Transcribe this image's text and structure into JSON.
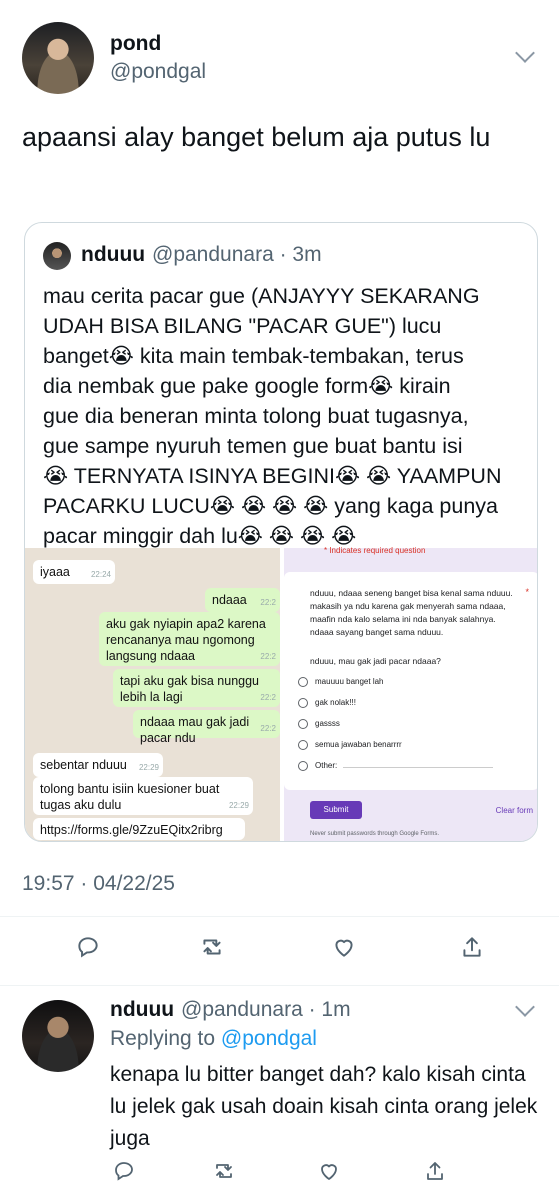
{
  "tweet": {
    "name": "pond",
    "handle": "@pondgal",
    "text": "apaansi alay banget belum aja putus lu",
    "timestamp": "19:57 · 04/22/25"
  },
  "quote": {
    "name": "nduuu",
    "handle_time": "@pandunara · 3m",
    "text_lines": [
      "mau cerita pacar gue (ANJAYYY SEKARANG",
      "UDAH BISA BILANG \"PACAR GUE\") lucu",
      "banget😭 kita main tembak-tembakan, terus",
      "dia nembak gue pake google form😭 kirain",
      "gue dia beneran minta tolong buat tugasnya,",
      "gue sampe nyuruh temen gue buat bantu isi",
      "😭 TERNYATA ISINYA BEGINI😭 😭 YAAMPUN",
      "PACARKU LUCU😭 😭 😭 😭 yang kaga punya",
      "pacar minggir dah lu😭 😭 😭 😭"
    ],
    "whatsapp": {
      "messages": [
        {
          "text": "iyaaa",
          "time": "22:24"
        },
        {
          "text": "ndaaa",
          "time": "22:2"
        },
        {
          "text": "aku gak nyiapin apa2 karena rencananya mau ngomong langsung ndaaa",
          "time": "22:2"
        },
        {
          "text": "tapi aku gak bisa nunggu lebih la lagi",
          "time": "22:2"
        },
        {
          "text": "ndaaa mau gak jadi pacar ndu",
          "time": "22:2"
        },
        {
          "text": "sebentar nduuu",
          "time": "22:29"
        },
        {
          "text": "tolong bantu isiin kuesioner buat tugas aku dulu",
          "time": "22:29"
        },
        {
          "text": "https://forms.gle/9ZzuEQitx2ribrg",
          "time": ""
        }
      ]
    },
    "form": {
      "required_note": "* Indicates required question",
      "question": "nduuu, ndaaa seneng banget bisa kenal sama nduuu. makasih ya ndu karena gak menyerah sama ndaaa, maafin nda kalo selama ini nda banyak salahnya. ndaaa sayang banget sama nduuu.",
      "question2": "nduuu, mau gak jadi pacar ndaaa?",
      "required_star": "*",
      "options": [
        "mauuuu banget lah",
        "gak nolak!!!",
        "gassss",
        "semua jawaban benarrrr",
        "Other:"
      ],
      "submit": "Submit",
      "clear": "Clear form",
      "footer": "Never submit passwords through Google Forms."
    }
  },
  "actions": [
    "reply-icon",
    "retweet-icon",
    "like-icon",
    "share-icon"
  ],
  "reply": {
    "name": "nduuu",
    "handle_time": "@pandunara · 1m",
    "replying_prefix": "Replying to",
    "replying_to": "@pondgal",
    "text": "kenapa lu bitter banget dah? kalo kisah cinta lu jelek gak usah doain kisah cinta orang jelek juga"
  }
}
